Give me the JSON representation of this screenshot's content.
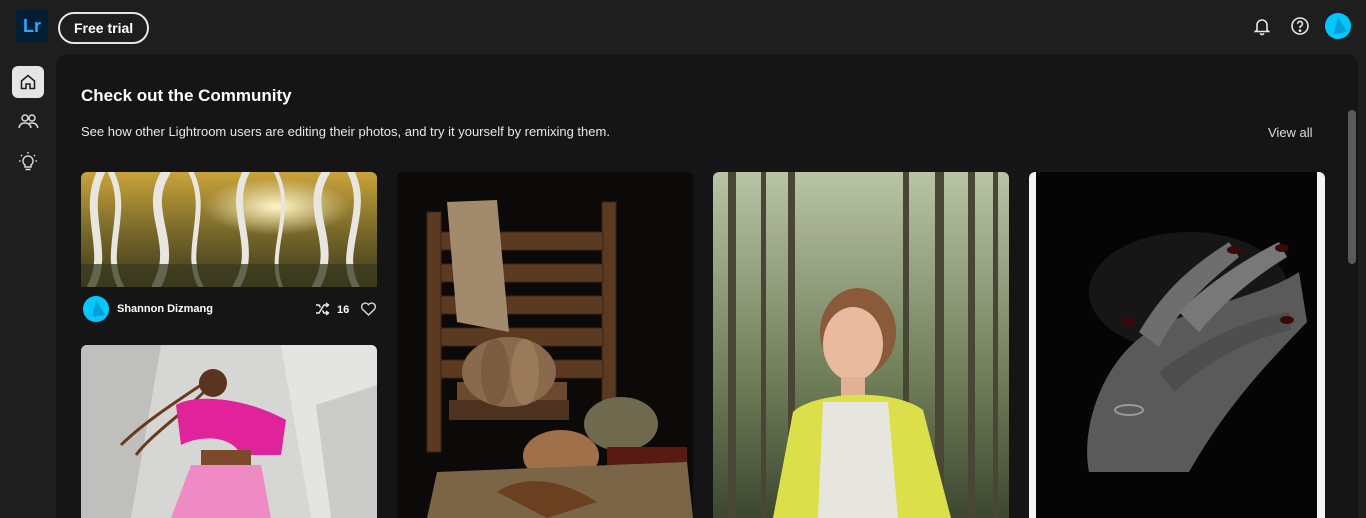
{
  "header": {
    "logo_text": "Lr",
    "free_trial_label": "Free trial",
    "icons": [
      "bell-icon",
      "help-icon",
      "profile-avatar"
    ]
  },
  "rail": {
    "items": [
      {
        "name": "home",
        "icon": "home-icon",
        "active": true
      },
      {
        "name": "community",
        "icon": "people-icon",
        "active": false
      },
      {
        "name": "learn",
        "icon": "lightbulb-icon",
        "active": false
      }
    ]
  },
  "community": {
    "title": "Check out the Community",
    "subtitle": "See how other Lightroom users are editing their photos, and try it yourself by remixing them.",
    "view_all_label": "View all",
    "cards": [
      {
        "author": "Shannon Dizmang",
        "remix_count": "16",
        "subject": "aspen-forest-photo"
      },
      {
        "subject": "pumpkins-still-life-photo"
      },
      {
        "subject": "woman-in-forest-photo"
      },
      {
        "subject": "hands-black-and-white-photo"
      },
      {
        "subject": "dancer-pink-outfit-photo"
      }
    ]
  },
  "colors": {
    "accent": "#00c8ff",
    "logo_bg": "#001e36",
    "logo_fg": "#31a8ff",
    "panel_bg": "#151515",
    "app_bg": "#1e1e1e"
  }
}
